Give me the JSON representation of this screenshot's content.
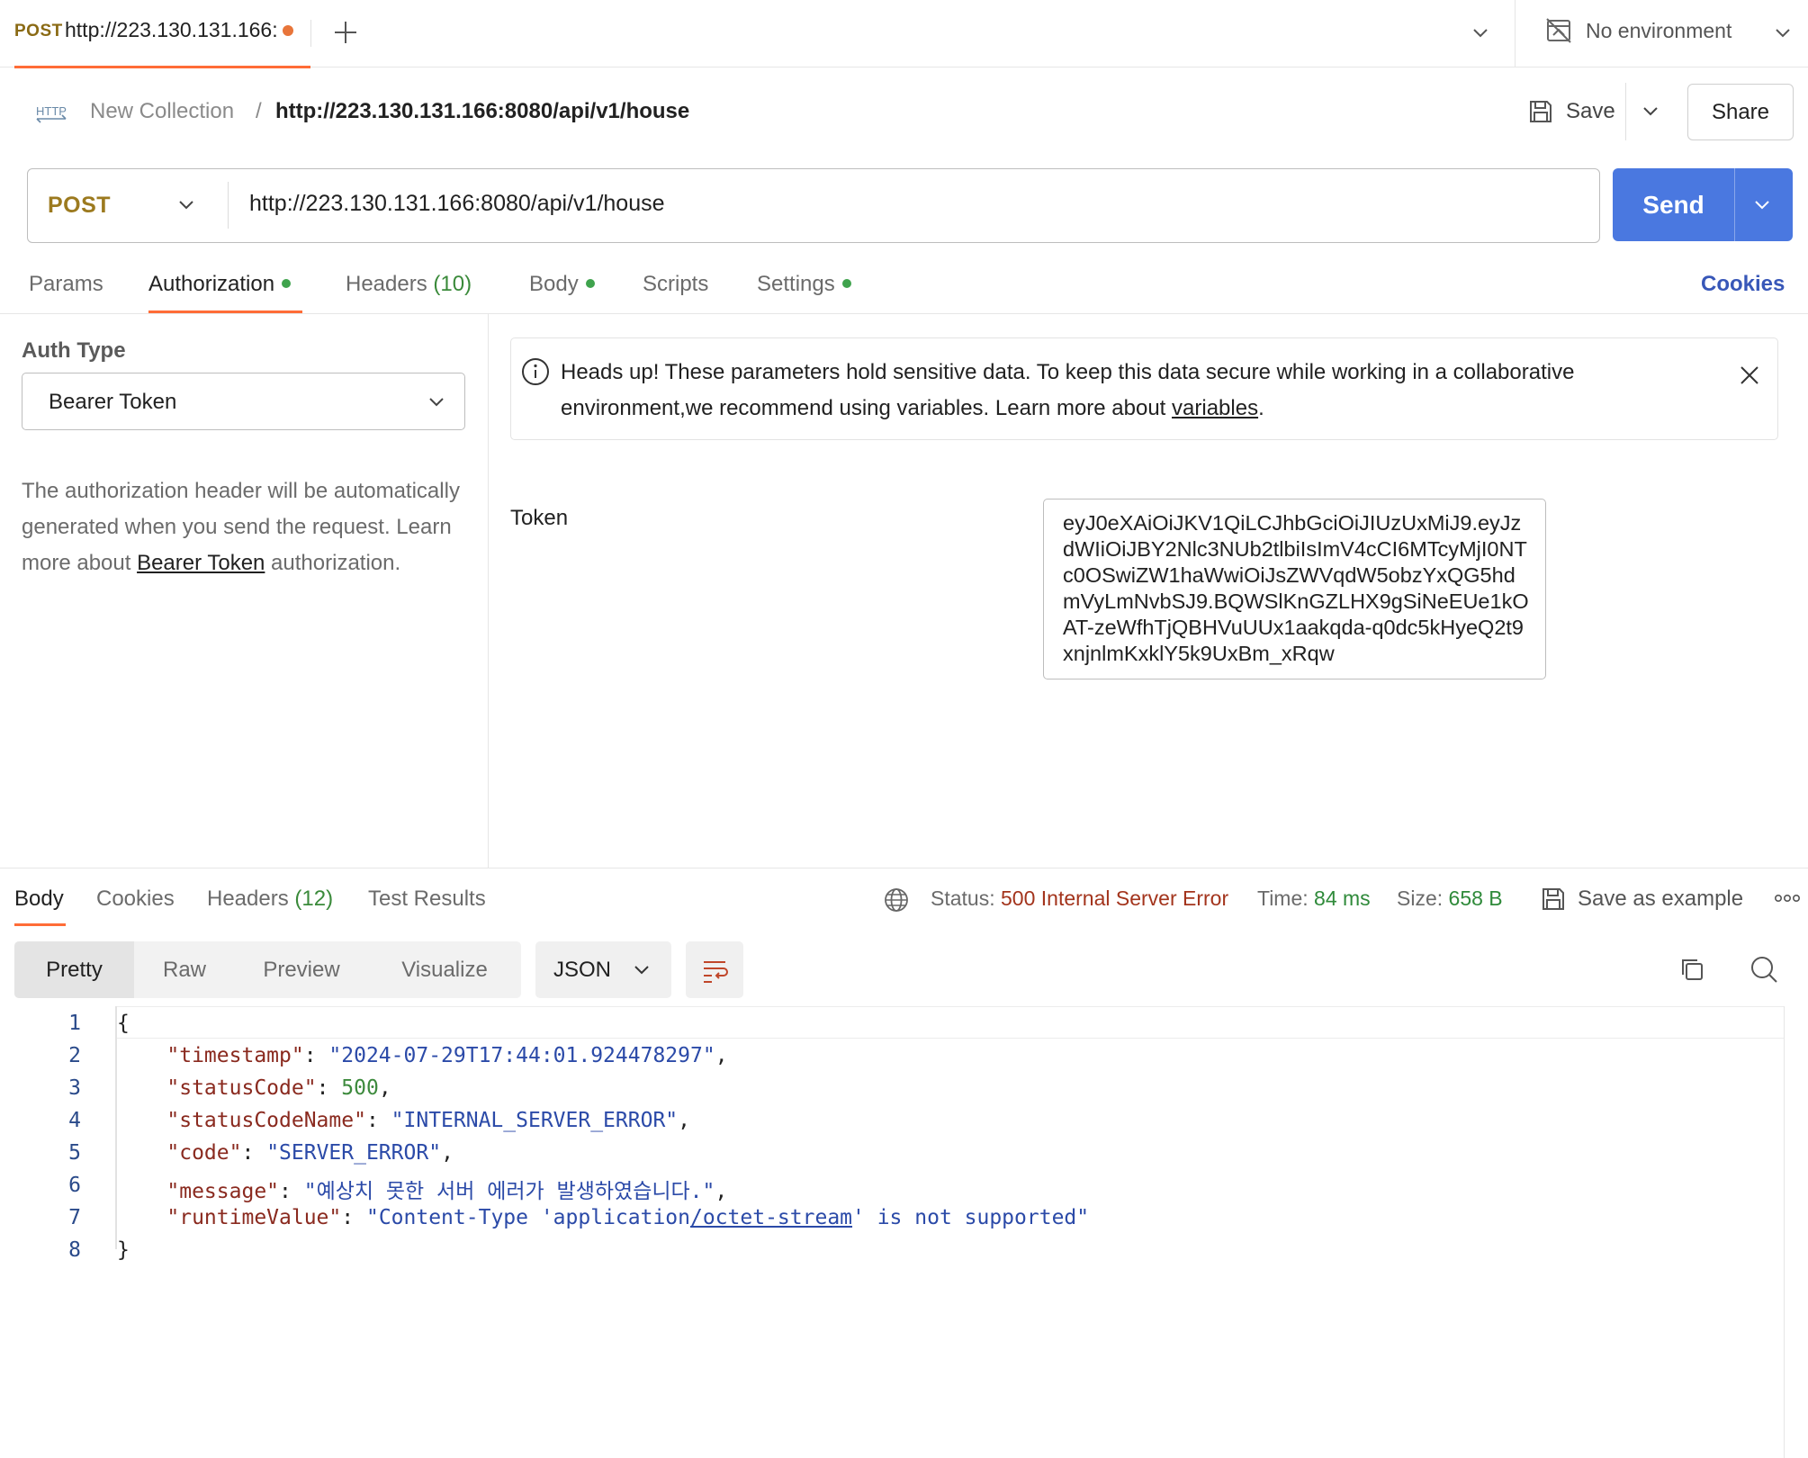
{
  "tab": {
    "method": "POST",
    "title": "http://223.130.131.166:",
    "unsaved": true
  },
  "environment": {
    "label": "No environment"
  },
  "breadcrumb": {
    "icon_text": "HTTP",
    "collection": "New Collection",
    "separator": "/",
    "request": "http://223.130.131.166:8080/api/v1/house"
  },
  "actions": {
    "save_label": "Save",
    "share_label": "Share"
  },
  "request": {
    "method": "POST",
    "url": "http://223.130.131.166:8080/api/v1/house",
    "send_label": "Send"
  },
  "request_tabs": {
    "params": "Params",
    "authorization": "Authorization",
    "headers": "Headers",
    "headers_count": "(10)",
    "body": "Body",
    "scripts": "Scripts",
    "settings": "Settings",
    "cookies": "Cookies"
  },
  "auth": {
    "type_label": "Auth Type",
    "type_value": "Bearer Token",
    "desc_before": "The authorization header will be automatically generated when you send the request. Learn more about ",
    "desc_link": "Bearer Token",
    "desc_after": " authorization.",
    "banner_text": "Heads up! These parameters hold sensitive data. To keep this data secure while working in a collaborative environment,we recommend using variables. Learn more about ",
    "banner_link": "variables",
    "banner_end": ".",
    "token_label": "Token",
    "token_value": "eyJ0eXAiOiJKV1QiLCJhbGciOiJIUzUxMiJ9.eyJzdWIiOiJBY2Nlc3NUb2tlbiIsImV4cCI6MTcyMjI0NTc0OSwiZW1haWwiOiJsZWVqdW5obzYxQG5hdmVyLmNvbSJ9.BQWSlKnGZLHX9gSiNeEUe1kOAT-zeWfhTjQBHVuUUx1aakqda-q0dc5kHyeQ2t9xnjnlmKxklY5k9UxBm_xRqw"
  },
  "response": {
    "tabs": {
      "body": "Body",
      "cookies": "Cookies",
      "headers": "Headers",
      "headers_count": "(12)",
      "test_results": "Test Results"
    },
    "status_label": "Status:",
    "status_value": "500 Internal Server Error",
    "time_label": "Time:",
    "time_value": "84 ms",
    "size_label": "Size:",
    "size_value": "658 B",
    "save_example": "Save as example",
    "formats": [
      "Pretty",
      "Raw",
      "Preview",
      "Visualize"
    ],
    "language": "JSON"
  },
  "code": {
    "line_numbers": [
      "1",
      "2",
      "3",
      "4",
      "5",
      "6",
      "7",
      "8"
    ],
    "open_brace": "{",
    "close_brace": "}",
    "lines": [
      {
        "key": "\"timestamp\"",
        "value": "\"2024-07-29T17:44:01.924478297\"",
        "type": "string"
      },
      {
        "key": "\"statusCode\"",
        "value": "500",
        "type": "number"
      },
      {
        "key": "\"statusCodeName\"",
        "value": "\"INTERNAL_SERVER_ERROR\"",
        "type": "string"
      },
      {
        "key": "\"code\"",
        "value": "\"SERVER_ERROR\"",
        "type": "string"
      },
      {
        "key": "\"message\"",
        "value": "\"예상치 못한 서버 에러가 발생하였습니다.\"",
        "type": "string"
      }
    ],
    "runtime_key": "\"runtimeValue\"",
    "runtime_value_a": "\"Content-Type 'application",
    "runtime_value_link": "/octet-stream",
    "runtime_value_b": "' is not supported\""
  },
  "colors": {
    "accent": "#ff6c37",
    "send": "#4a78e0",
    "method_post": "#9c7a1f",
    "ok_green": "#3fa34d",
    "error_red": "#a3341c",
    "link_blue": "#3857b8"
  },
  "icons": {
    "tab_add": "plus-icon",
    "tabs_menu": "chevron-down-icon",
    "environment": "no-environment-icon",
    "save": "floppy-disk-icon",
    "info": "info-circle-icon",
    "close": "close-icon",
    "globe": "globe-icon",
    "more": "ellipsis-icon",
    "wrap": "word-wrap-icon",
    "copy": "copy-icon",
    "search": "search-icon"
  }
}
